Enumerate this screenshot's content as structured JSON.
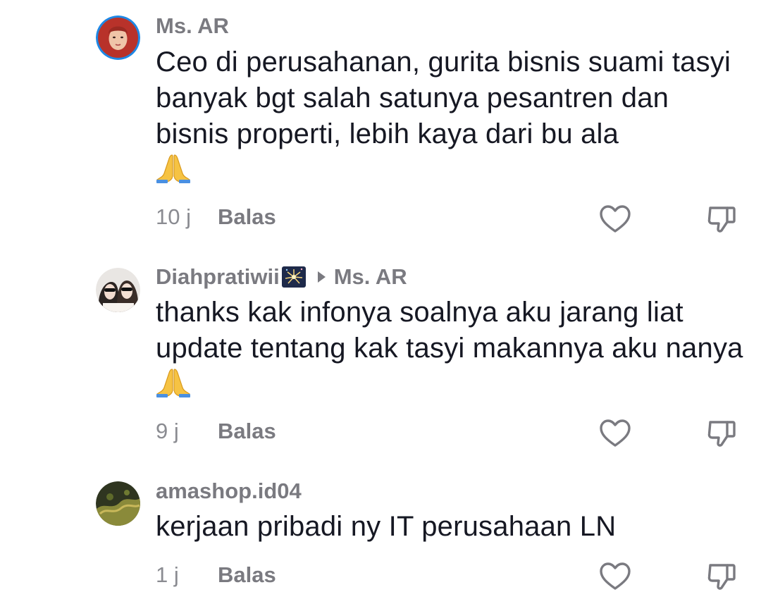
{
  "comments": [
    {
      "username": "Ms. AR",
      "text": "Ceo di perusahanan, gurita bisnis suami tasyi banyak bgt salah satunya pesantren dan bisnis properti, lebih kaya dari bu ala",
      "emoji_suffix": "praying-hands",
      "time": "10 j",
      "reply_label": "Balas"
    },
    {
      "username": "Diahpratiwii",
      "username_emoji": "sparkler-fireworks",
      "reply_to": "Ms. AR",
      "text": "thanks kak infonya soalnya aku jarang liat update tentang kak tasyi makannya aku nanya",
      "emoji_suffix": "praying-hands",
      "time": "9 j",
      "reply_label": "Balas"
    },
    {
      "username": "amashop.id04",
      "text": "kerjaan pribadi ny IT perusahaan LN",
      "time": "1 j",
      "reply_label": "Balas"
    }
  ],
  "icons": {
    "like": "heart-outline-icon",
    "dislike": "thumbs-down-outline-icon"
  },
  "colors": {
    "text_primary": "#161823",
    "text_secondary": "#7a7a80",
    "avatar_ring": "#1e88e5"
  }
}
